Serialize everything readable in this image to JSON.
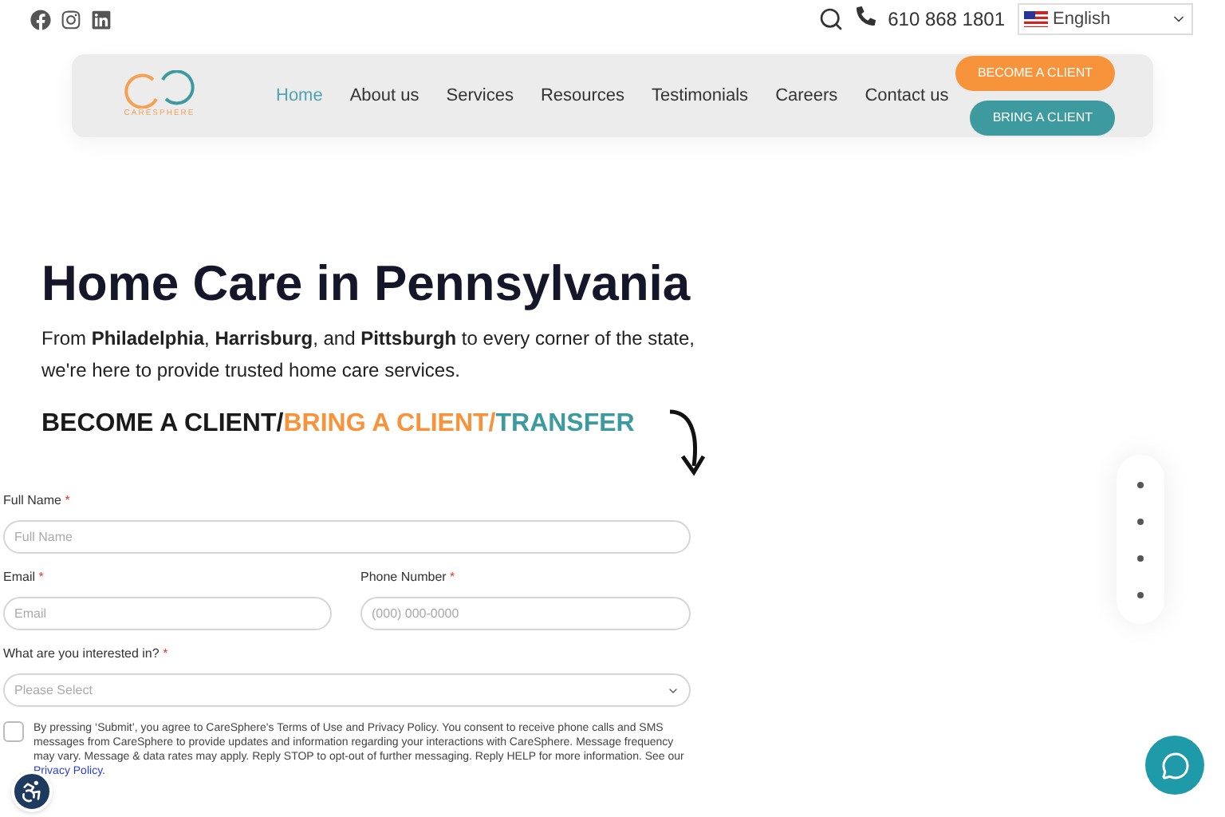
{
  "topbar": {
    "phone": "610 868 1801",
    "language": "English"
  },
  "nav": {
    "logo": "CARESPHERE",
    "items": [
      {
        "label": "Home",
        "selected": true
      },
      {
        "label": "About us",
        "selected": false
      },
      {
        "label": "Services",
        "selected": false
      },
      {
        "label": "Resources",
        "selected": false
      },
      {
        "label": "Testimonials",
        "selected": false
      },
      {
        "label": "Careers",
        "selected": false
      },
      {
        "label": "Contact us",
        "selected": false
      }
    ],
    "buttons": [
      {
        "label": "BECOME A CLIENT",
        "color": "#f7933a"
      },
      {
        "label": "BRING A CLIENT",
        "color": "#3d9a9e"
      }
    ]
  },
  "hero": {
    "title": "Home Care in Pennsylvania",
    "text": "From **Philadelphia**, **Harrisburg**, and **Pittsburgh** to every corner of the state, we're here to provide trusted home care services.",
    "tagline": [
      {
        "text": "BECOME A CLIENT/",
        "color": "#1a1a1a"
      },
      {
        "text": "BRING A CLIENT/",
        "color": "#f7933a"
      },
      {
        "text": "TRANSFER",
        "color": "#3d9a9e"
      }
    ]
  },
  "form": {
    "full_name": {
      "label": "Full Name",
      "required": "*",
      "placeholder": "Full Name"
    },
    "email": {
      "label": "Email",
      "required": "*",
      "placeholder": "Email"
    },
    "phone": {
      "label": "Phone Number",
      "required": "*",
      "placeholder": "(000) 000-0000"
    },
    "interest": {
      "label": "What are you interested in?",
      "required": "*",
      "placeholder": "Please Select"
    },
    "consent": {
      "checked": false,
      "text": "By pressing ‘Submit’, you agree to CareSphere's Terms of Use and Privacy Policy. You consent to receive phone calls and SMS messages from CareSphere to provide updates and information regarding your interactions with CareSphere. Message frequency may vary. Message & data rates may apply. Reply STOP to opt-out of further messaging. Reply HELP for more information. See our",
      "link": "Privacy Policy."
    }
  },
  "slider_dots": [
    {
      "selected": false
    },
    {
      "selected": false
    },
    {
      "selected": false
    },
    {
      "selected": false
    }
  ]
}
